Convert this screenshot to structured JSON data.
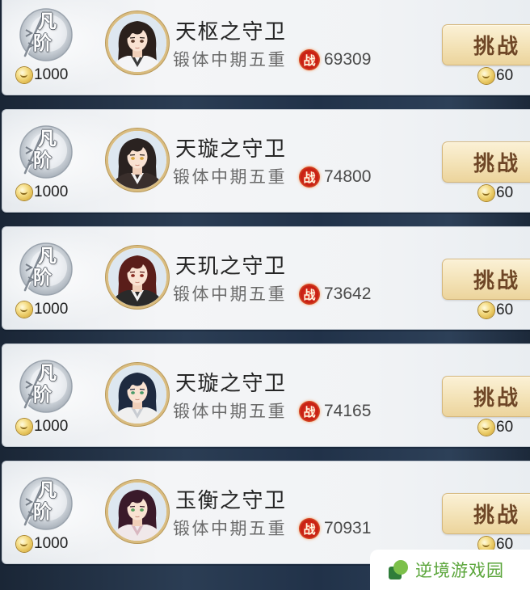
{
  "rows": [
    {
      "rank_top": "凡",
      "rank_bottom": "阶",
      "rank_cost": "1000",
      "name": "天枢之守卫",
      "realm": "锻体中期五重",
      "power_label": "战",
      "power": "69309",
      "challenge_label": "挑战",
      "challenge_cost": "60",
      "avatar": {
        "hair": "#2b201c",
        "eyes": "#5b3b2b",
        "outfit": "#f4f4f6",
        "collar": "#3a3a3a"
      }
    },
    {
      "rank_top": "凡",
      "rank_bottom": "阶",
      "rank_cost": "1000",
      "name": "天璇之守卫",
      "realm": "锻体中期五重",
      "power_label": "战",
      "power": "74800",
      "challenge_label": "挑战",
      "challenge_cost": "60",
      "avatar": {
        "hair": "#2a2220",
        "eyes": "#d4a540",
        "outfit": "#3a2f2c",
        "collar": "#f2f2f2"
      }
    },
    {
      "rank_top": "凡",
      "rank_bottom": "阶",
      "rank_cost": "1000",
      "name": "天玑之守卫",
      "realm": "锻体中期五重",
      "power_label": "战",
      "power": "73642",
      "challenge_label": "挑战",
      "challenge_cost": "60",
      "avatar": {
        "hair": "#5a1e1a",
        "eyes": "#8a2a20",
        "outfit": "#2a2a2a",
        "collar": "#f2f2f2"
      }
    },
    {
      "rank_top": "凡",
      "rank_bottom": "阶",
      "rank_cost": "1000",
      "name": "天璇之守卫",
      "realm": "锻体中期五重",
      "power_label": "战",
      "power": "74165",
      "challenge_label": "挑战",
      "challenge_cost": "60",
      "avatar": {
        "hair": "#1e2a40",
        "eyes": "#4a9a6a",
        "outfit": "#f0f0f0",
        "collar": "#c8ccd2"
      }
    },
    {
      "rank_top": "凡",
      "rank_bottom": "阶",
      "rank_cost": "1000",
      "name": "玉衡之守卫",
      "realm": "锻体中期五重",
      "power_label": "战",
      "power": "70931",
      "challenge_label": "挑战",
      "challenge_cost": "60",
      "avatar": {
        "hair": "#3a1a2a",
        "eyes": "#5aa060",
        "outfit": "#f0e8ea",
        "collar": "#d9b7c0"
      }
    }
  ],
  "watermark": {
    "text": "逆境游戏园"
  },
  "icons": {
    "rank_emblem": "rank-emblem-icon",
    "coin": "coin-icon",
    "combat_power": "combat-power-icon",
    "watermark_logo": "leaf-logo-icon"
  },
  "colors": {
    "button_text": "#6e4626",
    "button_bg": "#f3e2b6",
    "power_icon": "#c61e12",
    "watermark_text": "#5aa53a",
    "avatar_bg": "#dde7f0"
  }
}
